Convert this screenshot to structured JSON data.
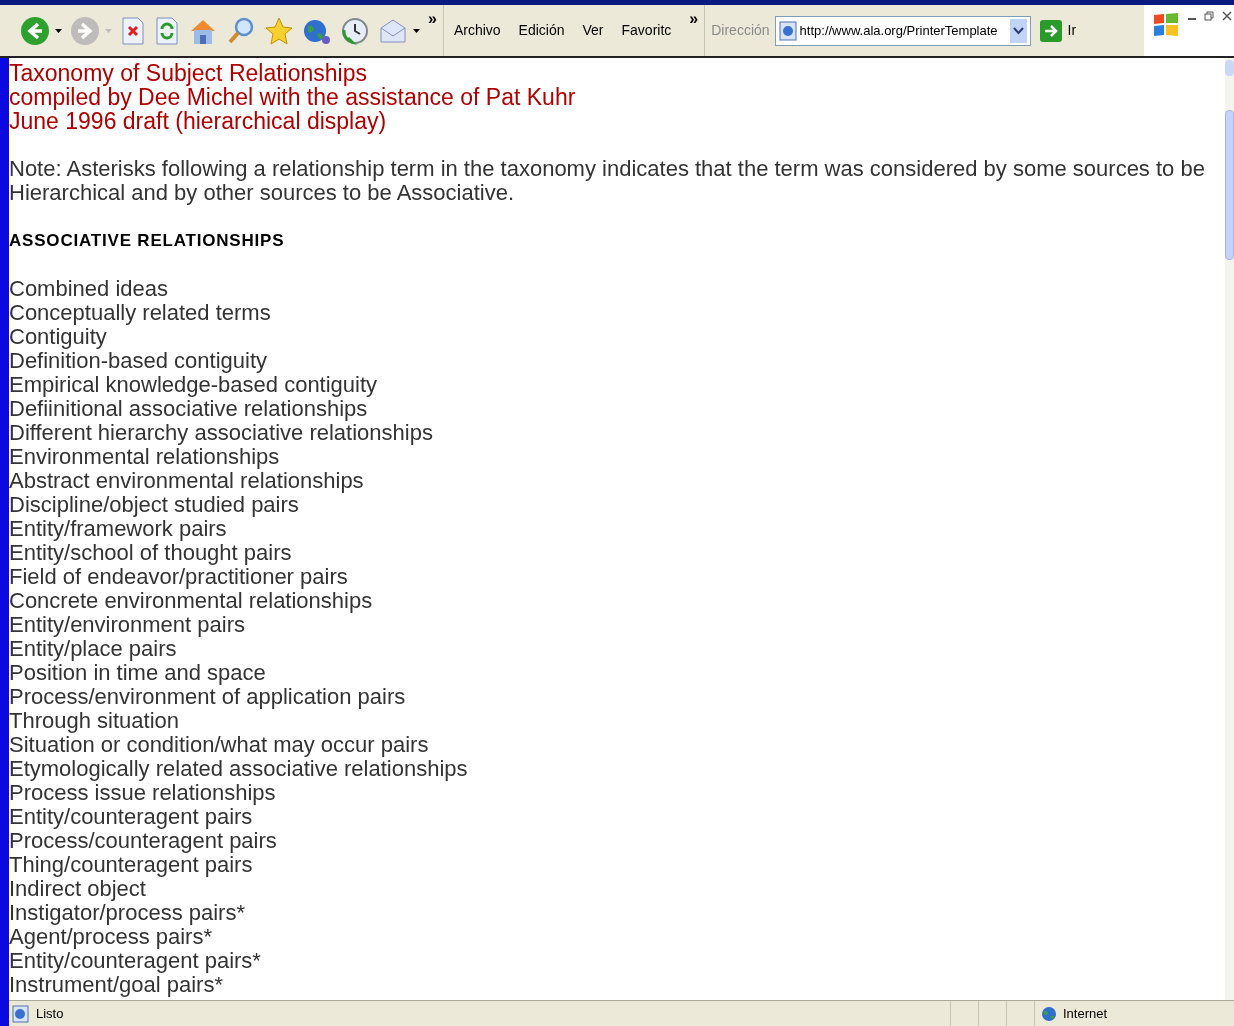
{
  "toolbar": {
    "buttons": [
      {
        "kind": "back",
        "disabled": false,
        "dropdown": true
      },
      {
        "kind": "forward",
        "disabled": true,
        "dropdown": true
      },
      {
        "kind": "stop",
        "disabled": false,
        "dropdown": false
      },
      {
        "kind": "refresh",
        "disabled": false,
        "dropdown": false
      },
      {
        "kind": "home",
        "disabled": false,
        "dropdown": false
      },
      {
        "kind": "search",
        "disabled": false,
        "dropdown": false
      },
      {
        "kind": "favorites",
        "disabled": false,
        "dropdown": false
      },
      {
        "kind": "media",
        "disabled": false,
        "dropdown": false
      },
      {
        "kind": "history",
        "disabled": false,
        "dropdown": false
      },
      {
        "kind": "mail",
        "disabled": false,
        "dropdown": true
      }
    ],
    "overflow": "»"
  },
  "menu": {
    "items": [
      "Archivo",
      "Edición",
      "Ver",
      "Favoritc"
    ],
    "overflow": "»"
  },
  "address": {
    "label": "Dirección",
    "value": "http://www.ala.org/PrinterTemplate",
    "go": "Ir"
  },
  "page": {
    "title_lines": [
      "Taxonomy of Subject Relationships",
      "compiled by Dee Michel with the assistance of Pat Kuhr",
      "June 1996 draft (hierarchical display)"
    ],
    "note": "Note: Asterisks following a relationship term in the taxonomy indicates that the term was considered by some sources to be Hierarchical and by other sources to be Associative.",
    "heading": "ASSOCIATIVE RELATIONSHIPS",
    "items": [
      "Combined ideas",
      "Conceptually related terms",
      "Contiguity",
      "Definition-based contiguity",
      "Empirical knowledge-based contiguity",
      "Defiinitional associative relationships",
      "Different hierarchy associative relationships",
      "Environmental relationships",
      "Abstract environmental relationships",
      "Discipline/object studied pairs",
      "Entity/framework pairs",
      "Entity/school of thought pairs",
      "Field of endeavor/practitioner pairs",
      "Concrete environmental relationships",
      "Entity/environment pairs",
      "Entity/place pairs",
      "Position in time and space",
      "Process/environment of application pairs",
      "Through situation",
      "Situation or condition/what may occur pairs",
      "Etymologically related associative relationships",
      "Process issue relationships",
      "Entity/counteragent pairs",
      "Process/counteragent pairs",
      "Thing/counteragent pairs",
      "Indirect object",
      "Instigator/process pairs*",
      "Agent/process pairs*",
      "Entity/counteragent pairs*",
      "Instrument/goal pairs*"
    ]
  },
  "status_bar": {
    "text": "Listo",
    "zone": "Internet"
  }
}
